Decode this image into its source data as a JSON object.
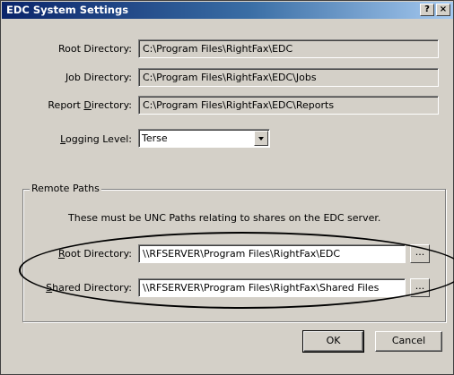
{
  "window": {
    "title": "EDC System Settings",
    "help_button": "?",
    "close_button": "×"
  },
  "local": {
    "root": {
      "label_pre": "Root Directory:",
      "value": "C:\\Program Files\\RightFax\\EDC"
    },
    "job": {
      "label_pre": "Job Directory:",
      "value": "C:\\Program Files\\RightFax\\EDC\\Jobs"
    },
    "report": {
      "label_pre": "Report ",
      "label_key": "D",
      "label_post": "irectory:",
      "value": "C:\\Program Files\\RightFax\\EDC\\Reports"
    },
    "logging": {
      "label_key": "L",
      "label_post": "ogging Level:",
      "value": "Terse"
    }
  },
  "remote": {
    "group_title": "Remote Paths",
    "note": "These must be UNC Paths relating to shares on the EDC server.",
    "root": {
      "label_key": "R",
      "label_post": "oot Directory:",
      "value": "\\\\RFSERVER\\Program Files\\RightFax\\EDC",
      "browse": "..."
    },
    "shared": {
      "label_key": "S",
      "label_post": "hared Directory:",
      "value": "\\\\RFSERVER\\Program Files\\RightFax\\Shared Files",
      "browse": "..."
    }
  },
  "buttons": {
    "ok": "OK",
    "cancel": "Cancel"
  }
}
